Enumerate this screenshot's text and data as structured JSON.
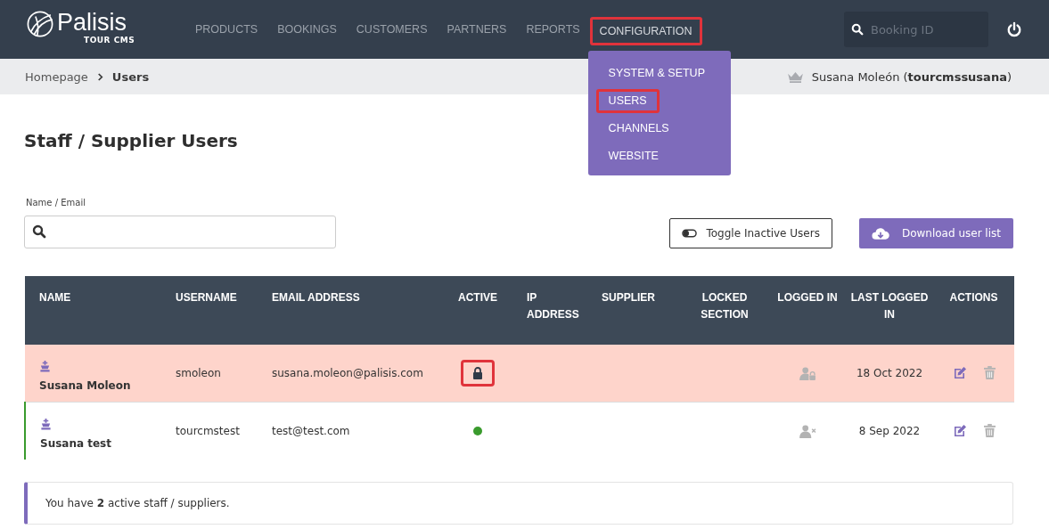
{
  "header": {
    "logo": {
      "name": "Palisis",
      "subtitle": "TOUR CMS"
    },
    "nav": [
      {
        "label": "PRODUCTS",
        "selected": false,
        "highlighted": false
      },
      {
        "label": "BOOKINGS",
        "selected": false,
        "highlighted": false
      },
      {
        "label": "CUSTOMERS",
        "selected": false,
        "highlighted": false
      },
      {
        "label": "PARTNERS",
        "selected": false,
        "highlighted": false
      },
      {
        "label": "REPORTS",
        "selected": false,
        "highlighted": false
      },
      {
        "label": "CONFIGURATION",
        "selected": true,
        "highlighted": true
      }
    ],
    "dropdown": [
      {
        "label": "SYSTEM & SETUP",
        "highlighted": false
      },
      {
        "label": "USERS",
        "highlighted": true
      },
      {
        "label": "CHANNELS",
        "highlighted": false
      },
      {
        "label": "WEBSITE",
        "highlighted": false
      }
    ],
    "search": {
      "placeholder": "Booking ID"
    }
  },
  "breadcrumb": [
    {
      "label": "Homepage",
      "current": false
    },
    {
      "label": "Users",
      "current": true
    }
  ],
  "current_user": {
    "label": "Susana Moleón (**tourcmssusana**)"
  },
  "page_title": "Staff / Supplier Users",
  "filter": {
    "label": "Name / Email"
  },
  "buttons": [
    {
      "kind": "toggle",
      "label": "Toggle Inactive Users"
    },
    {
      "kind": "download",
      "label": "Download user list"
    }
  ],
  "table": {
    "columns": [
      "NAME",
      "USERNAME",
      "EMAIL ADDRESS",
      "ACTIVE",
      "IP ADDRESS",
      "SUPPLIER",
      "LOCKED SECTION",
      "LOGGED IN",
      "LAST LOGGED IN",
      "ACTIONS"
    ],
    "rows": [
      {
        "name": "Susana Moleon",
        "username": "smoleon",
        "email": "susana.moleon@palisis.com",
        "locked": true,
        "status_highlighted": true,
        "session_locked": true,
        "last_logged_in": "18 Oct 2022"
      },
      {
        "name": "Susana test",
        "username": "tourcmstest",
        "email": "test@test.com",
        "locked": false,
        "status_highlighted": false,
        "session_locked": false,
        "last_logged_in": "8 Sep 2022"
      }
    ]
  },
  "info": "You have **2** active staff / suppliers."
}
